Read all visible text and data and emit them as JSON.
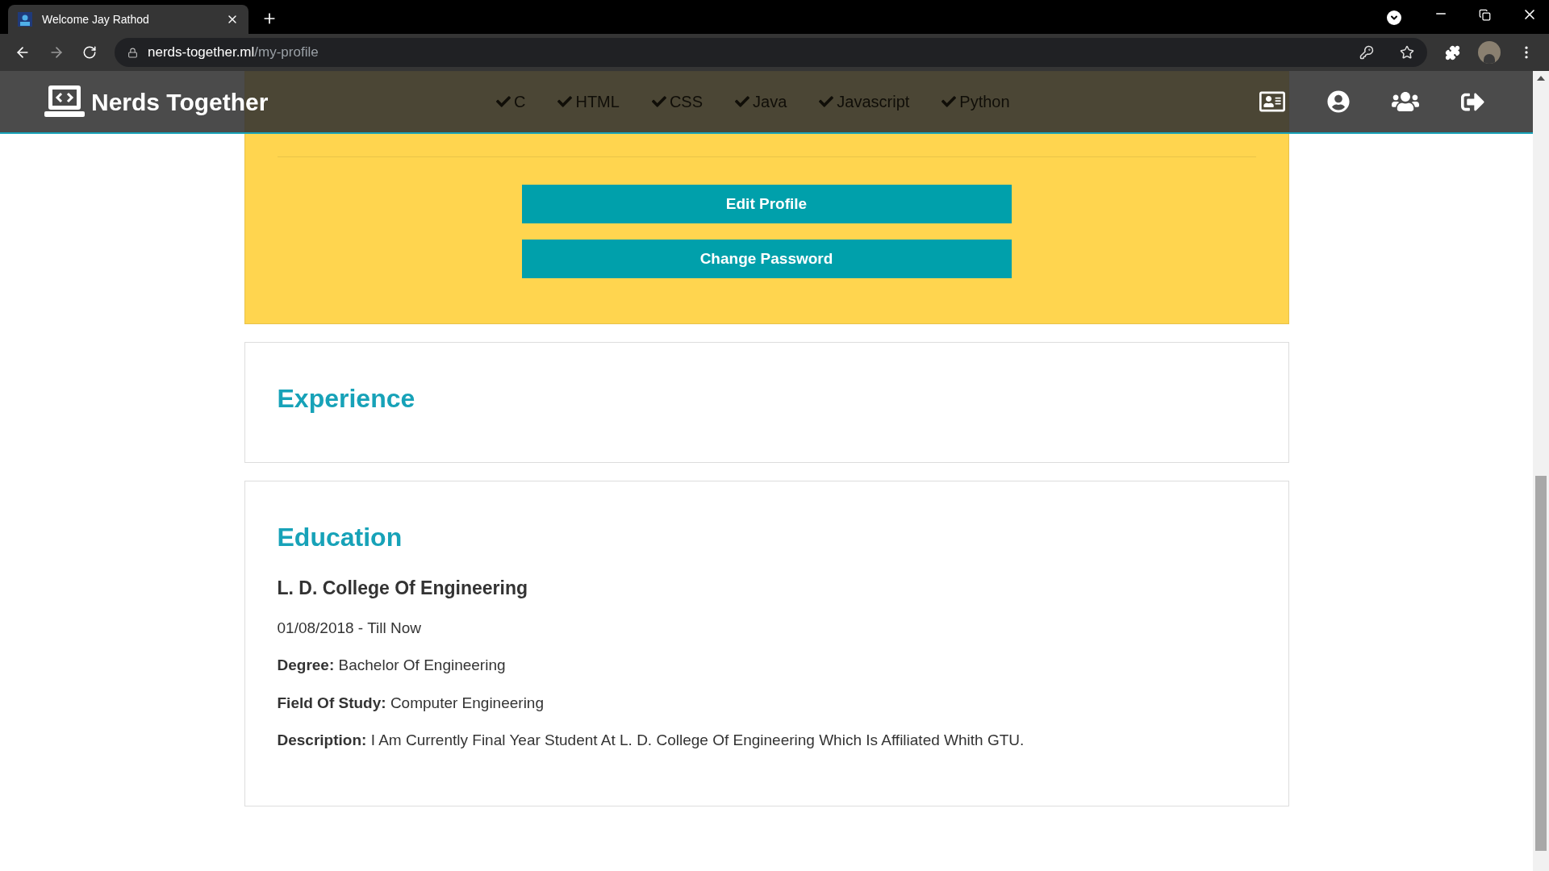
{
  "browser": {
    "tab": {
      "title": "Welcome Jay Rathod"
    },
    "url": {
      "host": "nerds-together.ml",
      "path": "/my-profile"
    }
  },
  "navbar": {
    "brand": "Nerds Together",
    "skills": [
      "C",
      "HTML",
      "CSS",
      "Java",
      "Javascript",
      "Python"
    ]
  },
  "profile_actions": [
    "Edit Profile",
    "Change Password"
  ],
  "experience": {
    "title": "Experience"
  },
  "education": {
    "title": "Education",
    "entries": [
      {
        "institution": "L. D. College Of Engineering",
        "dates": "01/08/2018 - Till Now",
        "fields": [
          {
            "label": "Degree:",
            "value": "Bachelor Of Engineering"
          },
          {
            "label": "Field Of Study:",
            "value": "Computer Engineering"
          },
          {
            "label": "Description:",
            "value": "I Am Currently Final Year Student At L. D. College Of Engineering Which Is Affiliated Whith GTU."
          }
        ]
      }
    ]
  }
}
